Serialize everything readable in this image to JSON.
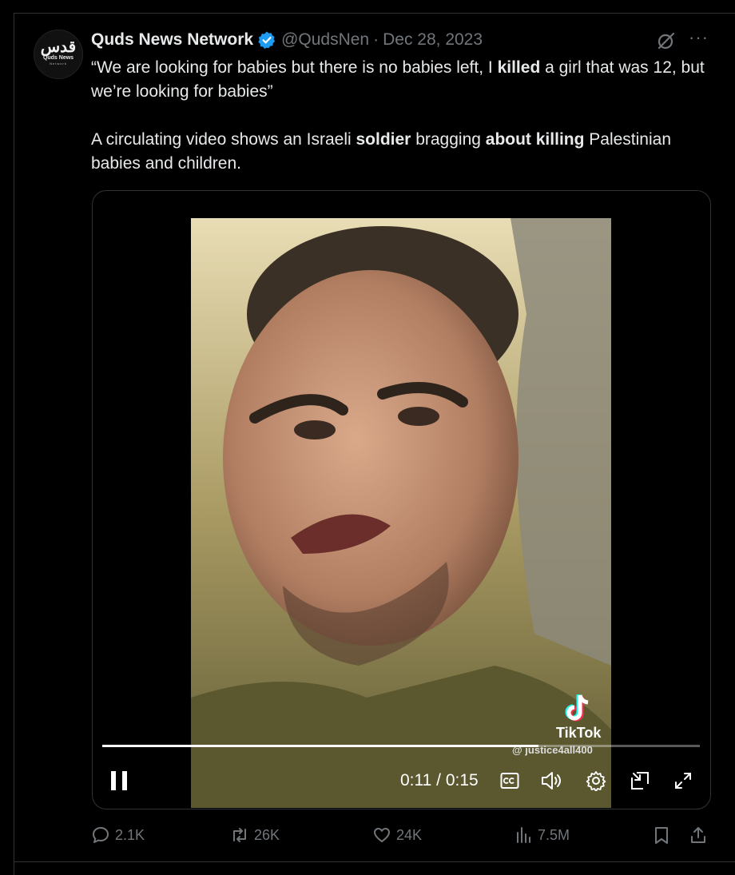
{
  "post": {
    "avatar": {
      "arabic": "قدس",
      "name": "Quds News",
      "sub": "Network"
    },
    "author": "Quds News Network",
    "handle": "@QudsNen",
    "separator": "·",
    "date": "Dec 28, 2023",
    "more": "···",
    "text": {
      "p1": [
        "“We are looking for babies but there is no babies left, I ",
        "killed",
        " a girl that was 12, but we’re looking for babies”"
      ],
      "p2": [
        "A circulating video shows an Israeli ",
        "soldier",
        " bragging ",
        "about killing",
        " Palestinian babies and children."
      ]
    },
    "video": {
      "watermark_name": "TikTok",
      "watermark_user": "@ justice4all400",
      "time": "0:11 / 0:15",
      "progress": 0.73
    },
    "actions": {
      "replies": "2.1K",
      "reposts": "26K",
      "likes": "24K",
      "views": "7.5M"
    }
  },
  "colors": {
    "background": "#000000",
    "text": "#e7e9ea",
    "muted": "#71767b",
    "verified": "#1d9bf0",
    "border": "#2f3336"
  }
}
